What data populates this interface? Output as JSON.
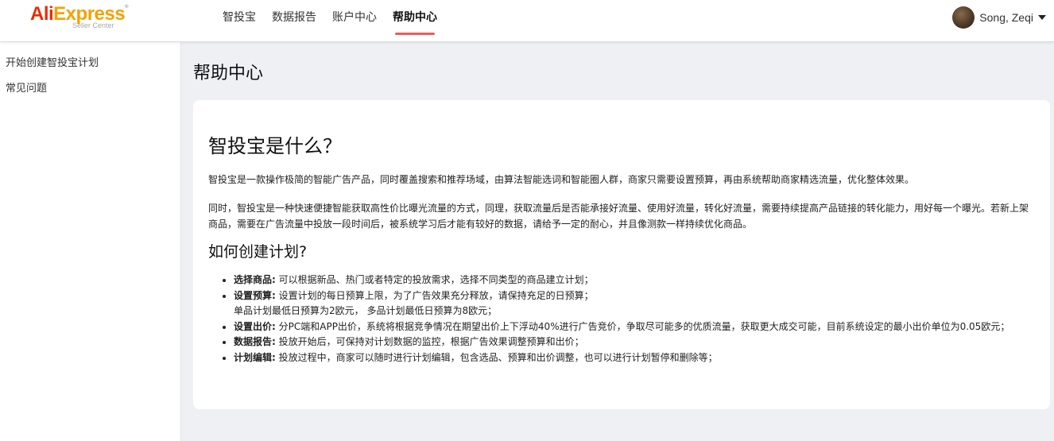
{
  "header": {
    "logo": {
      "ali": "Ali",
      "express": "Express",
      "sub": "Seller Center"
    },
    "nav": [
      {
        "label": "智投宝"
      },
      {
        "label": "数据报告"
      },
      {
        "label": "账户中心"
      },
      {
        "label": "帮助中心",
        "active": true
      }
    ],
    "user": {
      "name": "Song, Zeqi"
    }
  },
  "sidebar": {
    "items": [
      {
        "label": "开始创建智投宝计划"
      },
      {
        "label": "常见问题"
      }
    ]
  },
  "main": {
    "title": "帮助中心",
    "section1": {
      "heading": "智投宝是什么？",
      "p1": "智投宝是一款操作极简的智能广告产品，同时覆盖搜索和推荐场域，由算法智能选词和智能圈人群，商家只需要设置预算，再由系统帮助商家精选流量，优化整体效果。",
      "p2": "同时，智投宝是一种快速便捷智能获取高性价比曝光流量的方式，同理，获取流量后是否能承接好流量、使用好流量，转化好流量，需要持续提高产品链接的转化能力，用好每一个曝光。若新上架商品，需要在广告流量中投放一段时间后，被系统学习后才能有较好的数据，请给予一定的耐心，并且像测款一样持续优化商品。"
    },
    "section2": {
      "heading": "如何创建计划?",
      "items": [
        {
          "label": "选择商品:",
          "text": " 可以根据新品、热门或者特定的投放需求，选择不同类型的商品建立计划；"
        },
        {
          "label": "设置预算:",
          "text": " 设置计划的每日预算上限，为了广告效果充分释放，请保持充足的日预算；",
          "sub": "单品计划最低日预算为2欧元， 多品计划最低日预算为8欧元；"
        },
        {
          "label": "设置出价:",
          "text": " 分PC端和APP出价，系统将根据竞争情况在期望出价上下浮动40%进行广告竞价，争取尽可能多的优质流量，获取更大成交可能，目前系统设定的最小出价单位为0.05欧元；"
        },
        {
          "label": "数据报告:",
          "text": " 投放开始后，可保持对计划数据的监控，根据广告效果调整预算和出价；"
        },
        {
          "label": "计划编辑:",
          "text": " 投放过程中，商家可以随时进行计划编辑，包含选品、预算和出价调整，也可以进行计划暂停和删除等；"
        }
      ]
    }
  }
}
